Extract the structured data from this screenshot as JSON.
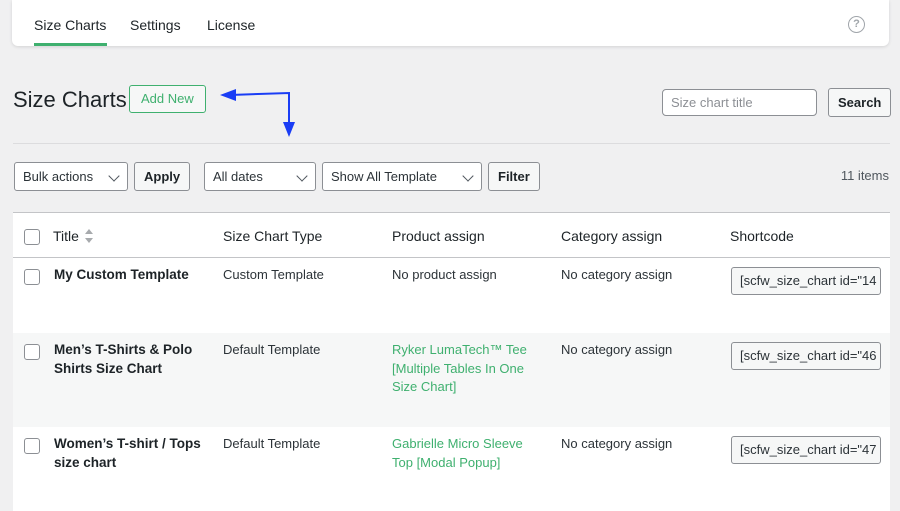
{
  "tabs": [
    {
      "label": "Size Charts",
      "active": true
    },
    {
      "label": "Settings",
      "active": false
    },
    {
      "label": "License",
      "active": false
    }
  ],
  "help_icon": "question-circle-icon",
  "page": {
    "title": "Size Charts",
    "add_new_label": "Add New"
  },
  "search": {
    "placeholder": "Size chart title",
    "button_label": "Search"
  },
  "filters": {
    "bulk_actions": "Bulk actions",
    "apply_label": "Apply",
    "dates": "All dates",
    "template": "Show All Template",
    "filter_label": "Filter",
    "items_count": "11 items"
  },
  "table": {
    "columns": {
      "title": "Title",
      "type": "Size Chart Type",
      "product": "Product assign",
      "category": "Category assign",
      "shortcode": "Shortcode"
    },
    "rows": [
      {
        "title": [
          "My Custom Template"
        ],
        "type": "Custom Template",
        "product": [
          "No product assign"
        ],
        "product_is_link": false,
        "category": "No category assign",
        "shortcode": "[scfw_size_chart id=\"14"
      },
      {
        "title": [
          "Men’s T-Shirts & Polo",
          "Shirts Size Chart"
        ],
        "type": "Default Template",
        "product": [
          "Ryker LumaTech™ Tee",
          "[Multiple Tables In One",
          "Size Chart]"
        ],
        "product_is_link": true,
        "category": "No category assign",
        "shortcode": "[scfw_size_chart id=\"46"
      },
      {
        "title": [
          "Women’s T-shirt / Tops",
          "size chart"
        ],
        "type": "Default Template",
        "product": [
          "Gabrielle Micro Sleeve",
          "Top [Modal Popup]"
        ],
        "product_is_link": true,
        "category": "No category assign",
        "shortcode": "[scfw_size_chart id=\"47"
      }
    ]
  },
  "colors": {
    "accent": "#3fb06f",
    "annotation_arrow": "#1a3df5"
  }
}
